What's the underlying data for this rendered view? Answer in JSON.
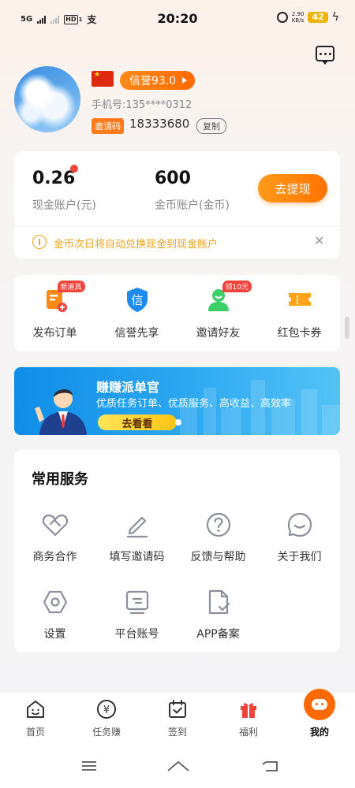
{
  "status_bar": {
    "network": "5G",
    "hd_badge": "HD",
    "hd_sub": "1",
    "time": "20:20",
    "speed_value": "2.90",
    "speed_unit": "KB/s",
    "battery": "42"
  },
  "profile": {
    "credit_badge": "信誉93.0",
    "phone": "手机号:135****0312",
    "invite_tag": "邀请码",
    "invite_code": "18333680",
    "copy_label": "复制"
  },
  "account": {
    "cash_value": "0.26",
    "cash_label": "现金账户(元)",
    "coin_value": "600",
    "coin_label": "金币账户(金币)",
    "withdraw_label": "去提现",
    "notice": "金币次日将自动兑换现金到现金账户"
  },
  "quick_actions": [
    {
      "label": "发布订单",
      "tag": "新道具"
    },
    {
      "label": "信誉先享",
      "tag": ""
    },
    {
      "label": "邀请好友",
      "tag": "领10元"
    },
    {
      "label": "红包卡券",
      "tag": ""
    }
  ],
  "banner": {
    "title": "赚赚派单官",
    "subtitle": "优质任务订单、优质服务、高收益、高效率",
    "button": "去看看"
  },
  "services": {
    "title": "常用服务",
    "items": [
      {
        "label": "商务合作"
      },
      {
        "label": "填写邀请码"
      },
      {
        "label": "反馈与帮助"
      },
      {
        "label": "关于我们"
      },
      {
        "label": "设置"
      },
      {
        "label": "平台账号"
      },
      {
        "label": "APP备案"
      }
    ]
  },
  "bottom_nav": [
    {
      "label": "首页"
    },
    {
      "label": "任务赚"
    },
    {
      "label": "签到"
    },
    {
      "label": "福利"
    },
    {
      "label": "我的"
    }
  ],
  "colors": {
    "accent": "#ff7300",
    "notice": "#f1a11c",
    "banner": "#1a97ec"
  }
}
